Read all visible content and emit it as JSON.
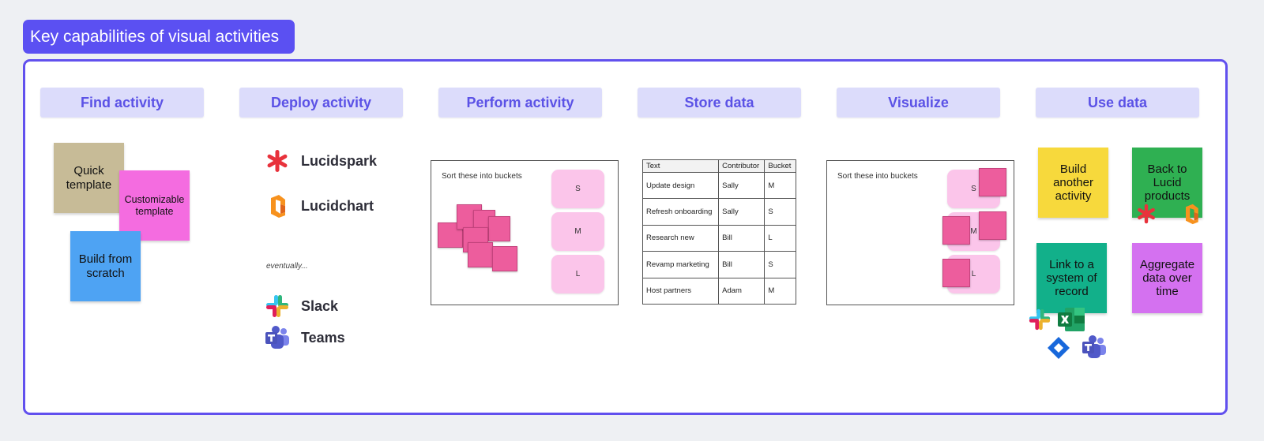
{
  "title": "Key capabilities of visual activities",
  "columns": [
    {
      "label": "Find activity"
    },
    {
      "label": "Deploy activity"
    },
    {
      "label": "Perform activity"
    },
    {
      "label": "Store data"
    },
    {
      "label": "Visualize"
    },
    {
      "label": "Use data"
    }
  ],
  "find": {
    "quick": "Quick template",
    "custom": "Customizable template",
    "scratch": "Build from scratch"
  },
  "deploy": {
    "lucidspark": "Lucidspark",
    "lucidchart": "Lucidchart",
    "eventually": "eventually...",
    "slack": "Slack",
    "teams": "Teams"
  },
  "perform": {
    "prompt": "Sort these into buckets",
    "buckets": [
      "S",
      "M",
      "L"
    ]
  },
  "store": {
    "headers": [
      "Text",
      "Contributor",
      "Bucket"
    ],
    "rows": [
      [
        "Update design",
        "Sally",
        "M"
      ],
      [
        "Refresh onboarding",
        "Sally",
        "S"
      ],
      [
        "Research new",
        "Bill",
        "L"
      ],
      [
        "Revamp marketing",
        "Bill",
        "S"
      ],
      [
        "Host partners",
        "Adam",
        "M"
      ]
    ]
  },
  "visualize": {
    "prompt": "Sort these into buckets",
    "buckets": [
      "S",
      "M",
      "L"
    ]
  },
  "use": {
    "another": "Build another activity",
    "back": "Back to Lucid products",
    "link": "Link to a system of record",
    "aggregate": "Aggregate data over time"
  },
  "colors": {
    "accent": "#5b50f2",
    "header_bg": "#dcdcfb",
    "sticky_tan": "#c7bb97",
    "sticky_pink": "#f46ce0",
    "sticky_blue": "#4ea3f3",
    "sticky_yellow": "#f7d93c",
    "sticky_green": "#2fb052",
    "sticky_teal": "#12b08a",
    "sticky_violet": "#d471f0"
  }
}
